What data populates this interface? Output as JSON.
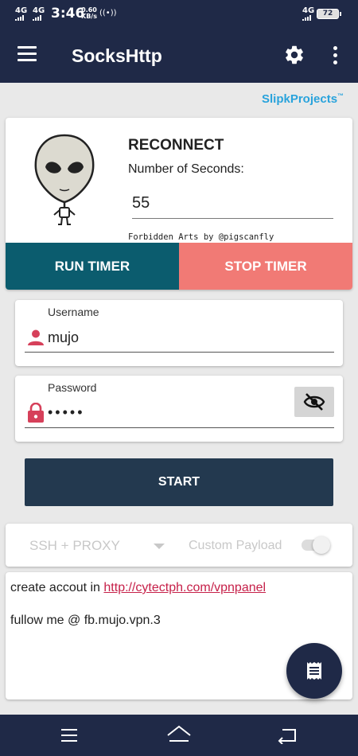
{
  "status_bar": {
    "network1": "4G",
    "network2": "4G",
    "time": "3:46",
    "speed_value": "0.60",
    "speed_unit": "KB/s",
    "hotspot": "((•))",
    "network_right": "4G",
    "battery": "72"
  },
  "app_bar": {
    "title": "SocksHttp",
    "icons": [
      "menu-icon",
      "gear-icon",
      "more-vert-icon"
    ]
  },
  "brand": {
    "name": "SlipkProjects",
    "mark": "™"
  },
  "reconnect": {
    "title": "RECONNECT",
    "seconds_label": "Number of Seconds:",
    "seconds_value": "55",
    "credit": "Forbidden Arts by @pigscanfly",
    "run_label": "RUN TIMER",
    "stop_label": "STOP TIMER",
    "run_color": "#0b5c6e",
    "stop_color": "#f17a75"
  },
  "login": {
    "username_label": "Username",
    "username_value": "mujo",
    "password_label": "Password",
    "password_value": "•••••"
  },
  "start_label": "START",
  "mode": {
    "selected": "SSH + PROXY",
    "payload_label": "Custom Payload",
    "payload_enabled": false
  },
  "log": {
    "line1_prefix": "create accout in ",
    "line1_link": "http://cytectph.com/vpnpanel",
    "line2": "fullow me @ fb.mujo.vpn.3"
  },
  "colors": {
    "primary_dark": "#1f2947",
    "brand_blue": "#29a3dc",
    "icon_red": "#d6405a",
    "link_red": "#c62049"
  }
}
